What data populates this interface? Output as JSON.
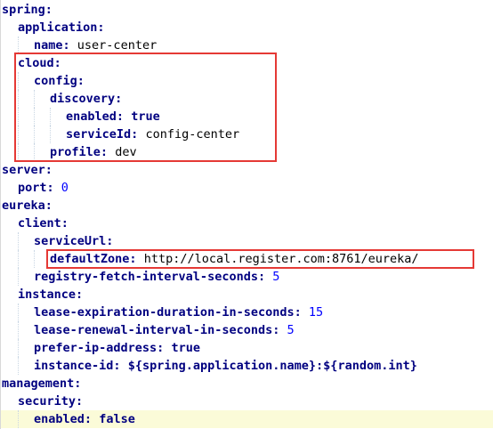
{
  "lines": [
    {
      "indent": 0,
      "key": "spring",
      "value": ""
    },
    {
      "indent": 1,
      "key": "application",
      "value": ""
    },
    {
      "indent": 2,
      "key": "name",
      "value": "user-center"
    },
    {
      "indent": 1,
      "key": "cloud",
      "value": ""
    },
    {
      "indent": 2,
      "key": "config",
      "value": ""
    },
    {
      "indent": 3,
      "key": "discovery",
      "value": ""
    },
    {
      "indent": 4,
      "key": "enabled",
      "value": "true"
    },
    {
      "indent": 4,
      "key": "serviceId",
      "value": "config-center"
    },
    {
      "indent": 3,
      "key": "profile",
      "value": "dev"
    },
    {
      "indent": 0,
      "key": "server",
      "value": ""
    },
    {
      "indent": 1,
      "key": "port",
      "value": "0"
    },
    {
      "indent": 0,
      "key": "eureka",
      "value": ""
    },
    {
      "indent": 1,
      "key": "client",
      "value": ""
    },
    {
      "indent": 2,
      "key": "serviceUrl",
      "value": ""
    },
    {
      "indent": 3,
      "key": "defaultZone",
      "value": "http://local.register.com:8761/eureka/"
    },
    {
      "indent": 2,
      "key": "registry-fetch-interval-seconds",
      "value": "5"
    },
    {
      "indent": 1,
      "key": "instance",
      "value": ""
    },
    {
      "indent": 2,
      "key": "lease-expiration-duration-in-seconds",
      "value": "15"
    },
    {
      "indent": 2,
      "key": "lease-renewal-interval-in-seconds",
      "value": "5"
    },
    {
      "indent": 2,
      "key": "prefer-ip-address",
      "value": "true"
    },
    {
      "indent": 2,
      "key": "instance-id",
      "value": "${spring.application.name}:${random.int}"
    },
    {
      "indent": 0,
      "key": "management",
      "value": ""
    },
    {
      "indent": 1,
      "key": "security",
      "value": ""
    },
    {
      "indent": 2,
      "key": "enabled",
      "value": "false"
    }
  ],
  "colors": {
    "key": "#000080",
    "number": "#0000ff",
    "highlight_border": "#e53935",
    "current_line": "#fbfbd8"
  },
  "highlighted_lines": [
    3,
    4,
    5,
    6,
    7,
    8,
    14
  ],
  "current_line_index": 23
}
